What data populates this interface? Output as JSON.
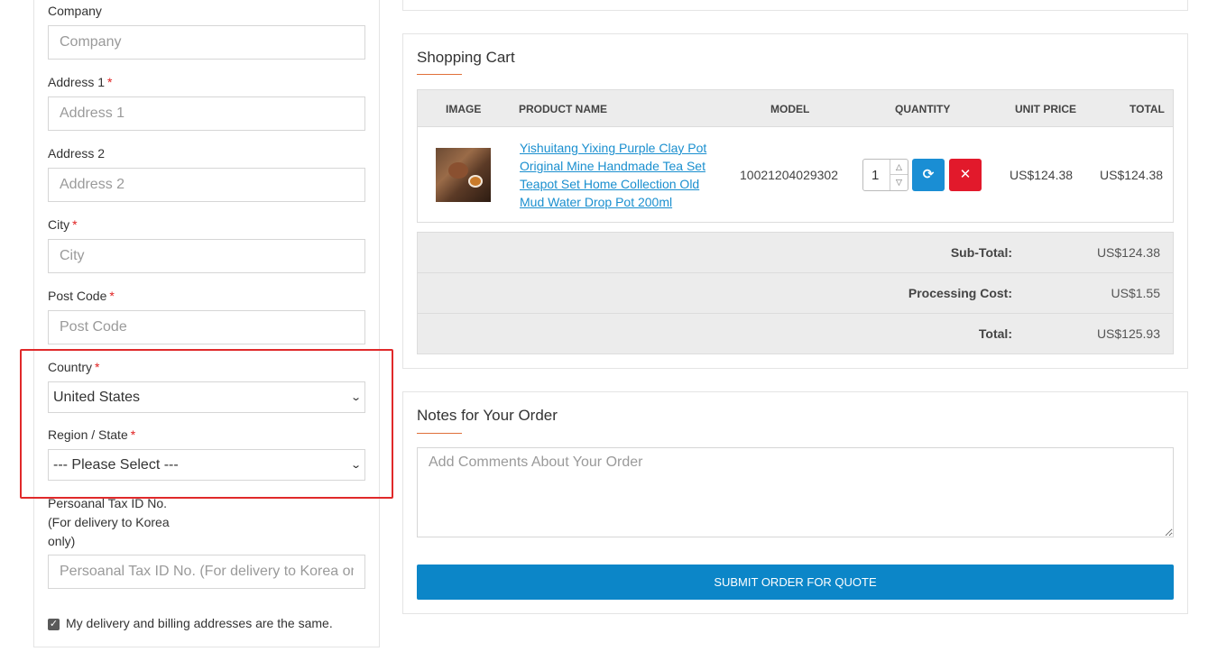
{
  "address_form": {
    "company": {
      "label": "Company",
      "placeholder": "Company",
      "required": false
    },
    "address1": {
      "label": "Address 1",
      "placeholder": "Address 1",
      "required": true
    },
    "address2": {
      "label": "Address 2",
      "placeholder": "Address 2",
      "required": false
    },
    "city": {
      "label": "City",
      "placeholder": "City",
      "required": true
    },
    "postcode": {
      "label": "Post Code",
      "placeholder": "Post Code",
      "required": true
    },
    "country": {
      "label": "Country",
      "value": "United States",
      "required": true
    },
    "region": {
      "label": "Region / State",
      "value": "--- Please Select ---",
      "required": true
    },
    "tax_id": {
      "label": "Persoanal Tax ID No. (For delivery to Korea only)",
      "placeholder": "Persoanal Tax ID No. (For delivery to Korea only)"
    },
    "same_address_checkbox": {
      "label": "My delivery and billing addresses are the same.",
      "checked": true
    },
    "required_marker": "*"
  },
  "cart": {
    "title": "Shopping Cart",
    "columns": [
      "Image",
      "Product Name",
      "Model",
      "Quantity",
      "Unit Price",
      "Total"
    ],
    "items": [
      {
        "product_name": "Yishuitang Yixing Purple Clay Pot Original Mine Handmade Tea Set Teapot Set Home Collection Old Mud Water Drop Pot 200ml",
        "model": "10021204029302",
        "quantity": "1",
        "unit_price": "US$124.38",
        "total": "US$124.38"
      }
    ],
    "totals": [
      {
        "label": "Sub-Total:",
        "value": "US$124.38"
      },
      {
        "label": "Processing Cost:",
        "value": "US$1.55"
      },
      {
        "label": "Total:",
        "value": "US$125.93"
      }
    ]
  },
  "notes": {
    "title": "Notes for Your Order",
    "placeholder": "Add Comments About Your Order"
  },
  "submit_label": "Submit Order For Quote",
  "colors": {
    "accent_blue": "#0c86c8",
    "danger_red": "#e2192b",
    "highlight_red": "#e0292a",
    "required_red": "#e02020",
    "link_blue": "#1a8fcf"
  }
}
